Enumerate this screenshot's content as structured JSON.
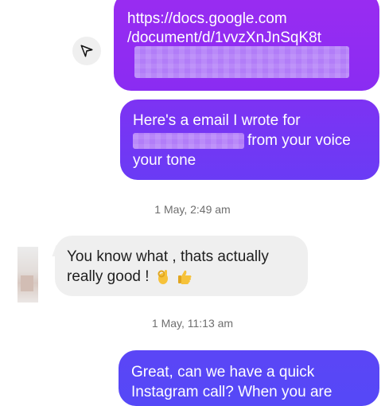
{
  "conversation": {
    "messages": [
      {
        "direction": "outgoing",
        "lines": [
          "https://docs.google.com",
          "/document/d/1vvzXnJnSqK8t"
        ],
        "redacted": true
      },
      {
        "direction": "outgoing",
        "line1": "Here's a email I wrote for",
        "line2_after_redaction": "from your voice",
        "line3": "your tone"
      },
      {
        "direction": "incoming",
        "line1": "You know what , thats actually",
        "line2": "really good !",
        "emojis": [
          "ok-hand-emoji",
          "thumbs-up-emoji"
        ]
      },
      {
        "direction": "outgoing",
        "line1": "Great, can we have a quick",
        "line2_partial": "Instagram call? When you are"
      }
    ],
    "timestamps": [
      "1 May, 2:49 am",
      "1 May, 11:13 am"
    ]
  },
  "icons": {
    "share": "send-icon"
  },
  "colors": {
    "bubble_out_top": "#9a2cf1",
    "bubble_out_mid": "#7433f4",
    "bubble_out_bottom": "#5548f7",
    "bubble_in": "#efefef",
    "timestamp": "#6e6e6e"
  }
}
